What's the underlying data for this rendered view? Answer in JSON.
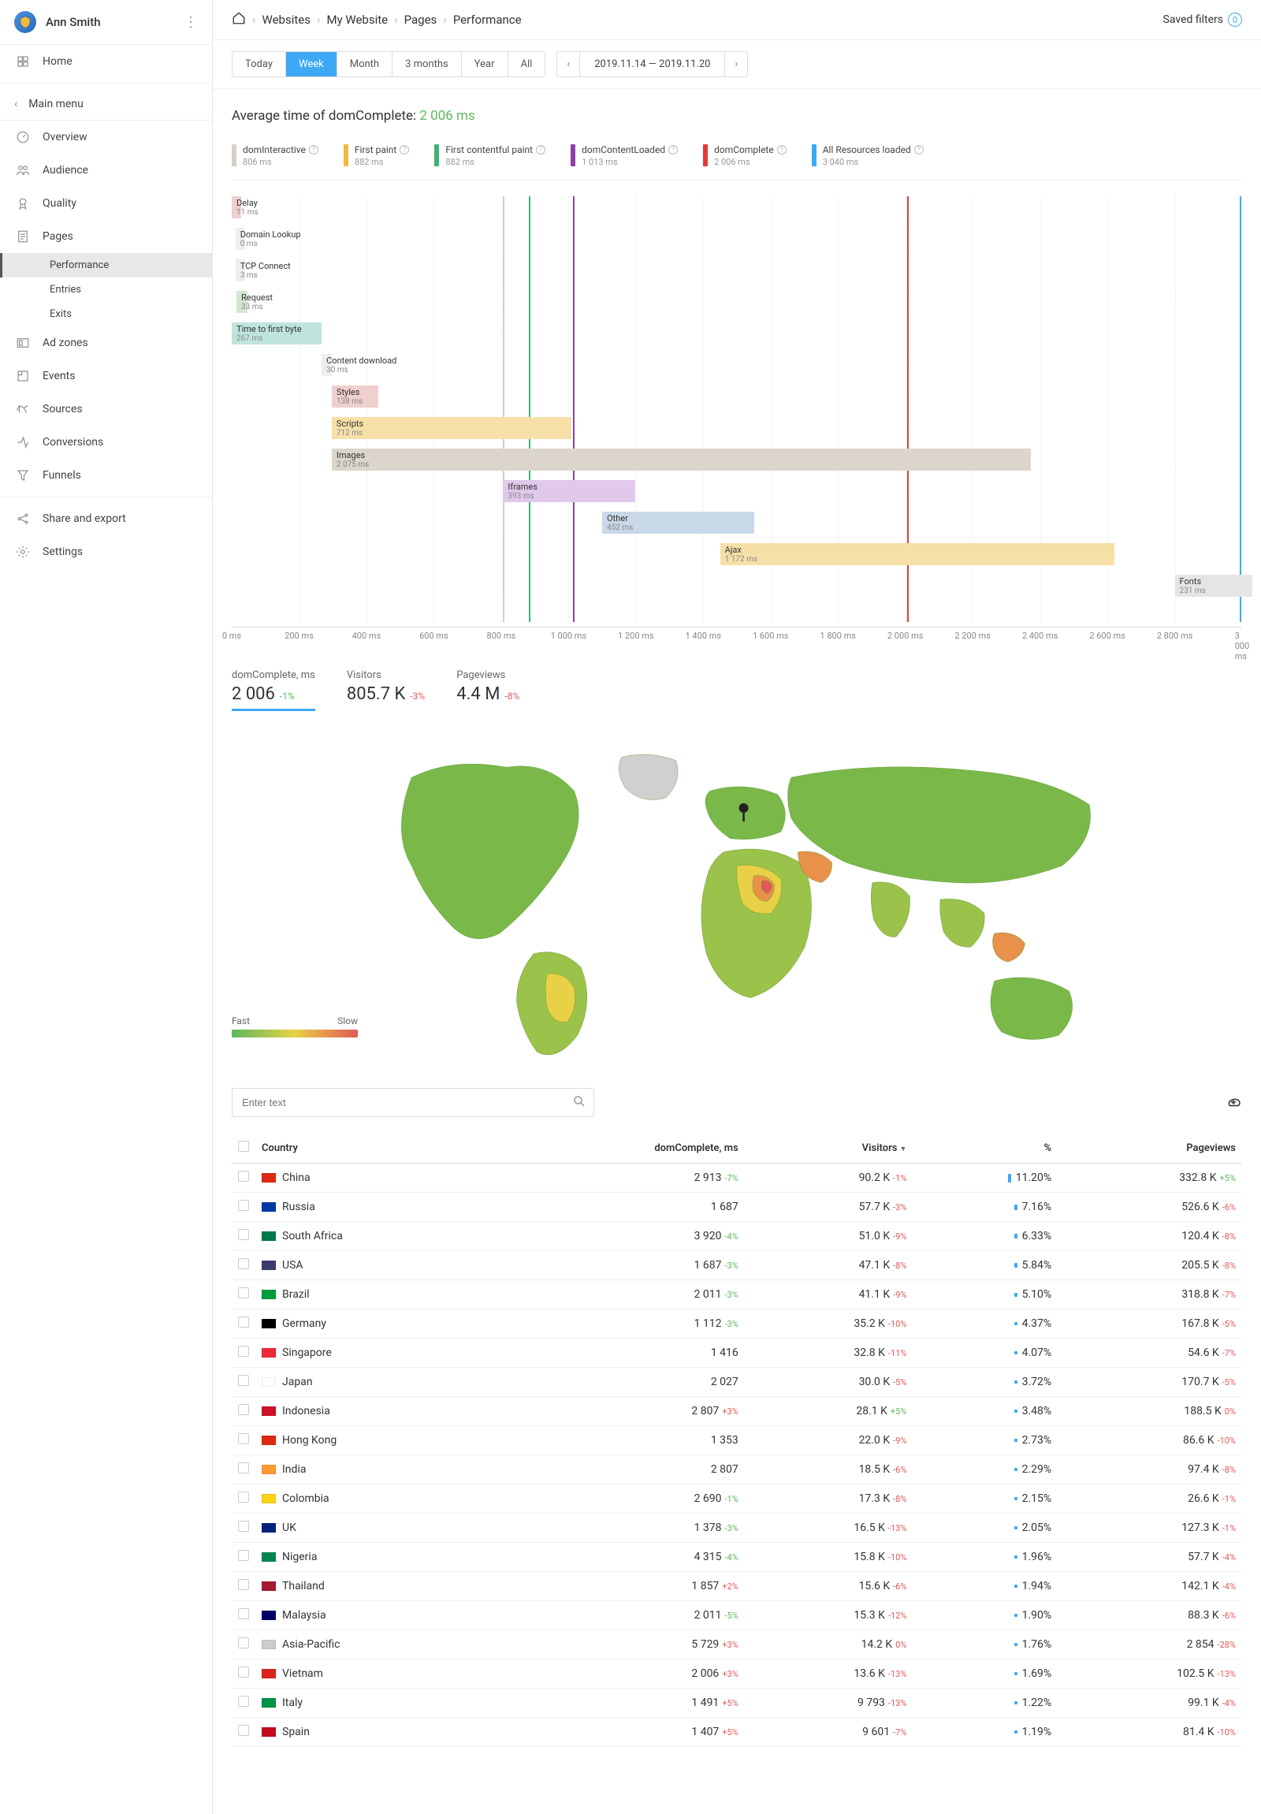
{
  "user": {
    "name": "Ann Smith"
  },
  "sidebar": {
    "home": "Home",
    "main_menu": "Main menu",
    "items": [
      {
        "label": "Overview",
        "icon": "gauge-icon"
      },
      {
        "label": "Audience",
        "icon": "users-icon"
      },
      {
        "label": "Quality",
        "icon": "ribbon-icon"
      },
      {
        "label": "Pages",
        "icon": "pages-icon",
        "expanded": true,
        "children": [
          {
            "label": "Performance",
            "active": true
          },
          {
            "label": "Entries"
          },
          {
            "label": "Exits"
          }
        ]
      },
      {
        "label": "Ad zones",
        "icon": "adzone-icon"
      },
      {
        "label": "Events",
        "icon": "events-icon"
      },
      {
        "label": "Sources",
        "icon": "sources-icon"
      },
      {
        "label": "Conversions",
        "icon": "conversions-icon"
      },
      {
        "label": "Funnels",
        "icon": "funnel-icon"
      }
    ],
    "footer": [
      {
        "label": "Share and export",
        "icon": "share-icon"
      },
      {
        "label": "Settings",
        "icon": "settings-icon"
      }
    ]
  },
  "breadcrumb": [
    "Websites",
    "My Website",
    "Pages",
    "Performance"
  ],
  "saved_filters": "Saved filters",
  "ranges": [
    "Today",
    "Week",
    "Month",
    "3 months",
    "Year",
    "All"
  ],
  "range_active": "Week",
  "date_range": "2019.11.14 — 2019.11.20",
  "chart_title_prefix": "Average time of domComplete: ",
  "chart_title_value": "2 006 ms",
  "legend": [
    {
      "name": "domInteractive",
      "value": "806 ms",
      "color": "#d6cfc5"
    },
    {
      "name": "First paint",
      "value": "882 ms",
      "color": "#f3b93e"
    },
    {
      "name": "First contentful paint",
      "value": "882 ms",
      "color": "#3cb371"
    },
    {
      "name": "domContentLoaded",
      "value": "1 013 ms",
      "color": "#8e3fa8"
    },
    {
      "name": "domComplete",
      "value": "2 006 ms",
      "color": "#e53935"
    },
    {
      "name": "All Resources loaded",
      "value": "3 040 ms",
      "color": "#3da9f5"
    }
  ],
  "chart_data": {
    "type": "bar",
    "xlim": [
      0,
      3000
    ],
    "xlabel_ticks": [
      "0 ms",
      "200 ms",
      "400 ms",
      "600 ms",
      "800 ms",
      "1 000 ms",
      "1 200 ms",
      "1 400 ms",
      "1 600 ms",
      "1 800 ms",
      "2 000 ms",
      "2 200 ms",
      "2 400 ms",
      "2 600 ms",
      "2 800 ms",
      "3 000 ms"
    ],
    "vlines": [
      {
        "x": 806,
        "color": "#d6cfc5"
      },
      {
        "x": 882,
        "color": "#f3b93e"
      },
      {
        "x": 882,
        "color": "#3cb371"
      },
      {
        "x": 1013,
        "color": "#8e3fa8"
      },
      {
        "x": 2006,
        "color": "#e53935"
      },
      {
        "x": 3040,
        "color": "#3da9f5"
      }
    ],
    "bars": [
      {
        "label": "Delay",
        "value": "11 ms",
        "start": 0,
        "dur": 11,
        "color": "#f0cfcf"
      },
      {
        "label": "Domain Lookup",
        "value": "0 ms",
        "start": 11,
        "dur": 0,
        "color": "#eee"
      },
      {
        "label": "TCP Connect",
        "value": "3 ms",
        "start": 11,
        "dur": 3,
        "color": "#eee"
      },
      {
        "label": "Request",
        "value": "33 ms",
        "start": 14,
        "dur": 33,
        "color": "#d3e8d3"
      },
      {
        "label": "Time to first byte",
        "value": "267 ms",
        "start": 0,
        "dur": 267,
        "color": "#bfe4dd"
      },
      {
        "label": "Content download",
        "value": "30 ms",
        "start": 267,
        "dur": 30,
        "color": "#eee"
      },
      {
        "label": "Styles",
        "value": "138 ms",
        "start": 297,
        "dur": 138,
        "color": "#f0cfcf"
      },
      {
        "label": "Scripts",
        "value": "712 ms",
        "start": 297,
        "dur": 712,
        "color": "#f6e0a8"
      },
      {
        "label": "Images",
        "value": "2 075 ms",
        "start": 297,
        "dur": 2075,
        "color": "#dcd5cb"
      },
      {
        "label": "Iframes",
        "value": "393 ms",
        "start": 806,
        "dur": 393,
        "color": "#e0c9ea"
      },
      {
        "label": "Other",
        "value": "452 ms",
        "start": 1100,
        "dur": 452,
        "color": "#c9d8e8"
      },
      {
        "label": "Ajax",
        "value": "1 172 ms",
        "start": 1450,
        "dur": 1172,
        "color": "#f6e0a8"
      },
      {
        "label": "Fonts",
        "value": "231 ms",
        "start": 2800,
        "dur": 231,
        "color": "#e5e5e5"
      }
    ]
  },
  "stats": [
    {
      "label": "domComplete, ms",
      "value": "2 006",
      "delta": "-1%",
      "delta_class": "green-t",
      "active": true
    },
    {
      "label": "Visitors",
      "value": "805.7 K",
      "delta": "-3%",
      "delta_class": "red-t"
    },
    {
      "label": "Pageviews",
      "value": "4.4 M",
      "delta": "-8%",
      "delta_class": "red-t"
    }
  ],
  "map_legend": {
    "fast": "Fast",
    "slow": "Slow"
  },
  "search_placeholder": "Enter text",
  "table": {
    "headers": [
      "Country",
      "domComplete, ms",
      "Visitors",
      "%",
      "Pageviews"
    ],
    "sort_col": "Visitors",
    "rows": [
      {
        "flag": "#de2910",
        "country": "China",
        "dom": "2 913",
        "dom_d": "-7%",
        "dom_c": "green-t",
        "vis": "90.2 K",
        "vis_d": "-1%",
        "vis_c": "red-t",
        "pct": "11.20%",
        "pv": "332.8 K",
        "pv_d": "+5%",
        "pv_c": "green-t"
      },
      {
        "flag": "#0039a6",
        "country": "Russia",
        "dom": "1 687",
        "dom_d": "",
        "dom_c": "",
        "vis": "57.7 K",
        "vis_d": "-3%",
        "vis_c": "red-t",
        "pct": "7.16%",
        "pv": "526.6 K",
        "pv_d": "-6%",
        "pv_c": "red-t"
      },
      {
        "flag": "#007a4d",
        "country": "South Africa",
        "dom": "3 920",
        "dom_d": "-4%",
        "dom_c": "green-t",
        "vis": "51.0 K",
        "vis_d": "-9%",
        "vis_c": "red-t",
        "pct": "6.33%",
        "pv": "120.4 K",
        "pv_d": "-8%",
        "pv_c": "red-t"
      },
      {
        "flag": "#3c3b6e",
        "country": "USA",
        "dom": "1 687",
        "dom_d": "-3%",
        "dom_c": "green-t",
        "vis": "47.1 K",
        "vis_d": "-8%",
        "vis_c": "red-t",
        "pct": "5.84%",
        "pv": "205.5 K",
        "pv_d": "-8%",
        "pv_c": "red-t"
      },
      {
        "flag": "#009c3b",
        "country": "Brazil",
        "dom": "2 011",
        "dom_d": "-3%",
        "dom_c": "green-t",
        "vis": "41.1 K",
        "vis_d": "-9%",
        "vis_c": "red-t",
        "pct": "5.10%",
        "pv": "318.8 K",
        "pv_d": "-7%",
        "pv_c": "red-t"
      },
      {
        "flag": "#000000",
        "country": "Germany",
        "dom": "1 112",
        "dom_d": "-3%",
        "dom_c": "green-t",
        "vis": "35.2 K",
        "vis_d": "-10%",
        "vis_c": "red-t",
        "pct": "4.37%",
        "pv": "167.8 K",
        "pv_d": "-5%",
        "pv_c": "red-t"
      },
      {
        "flag": "#ed2939",
        "country": "Singapore",
        "dom": "1 416",
        "dom_d": "",
        "dom_c": "",
        "vis": "32.8 K",
        "vis_d": "-11%",
        "vis_c": "red-t",
        "pct": "4.07%",
        "pv": "54.6 K",
        "pv_d": "-7%",
        "pv_c": "red-t"
      },
      {
        "flag": "#ffffff",
        "country": "Japan",
        "dom": "2 027",
        "dom_d": "",
        "dom_c": "",
        "vis": "30.0 K",
        "vis_d": "-5%",
        "vis_c": "red-t",
        "pct": "3.72%",
        "pv": "170.7 K",
        "pv_d": "-5%",
        "pv_c": "red-t"
      },
      {
        "flag": "#ce1126",
        "country": "Indonesia",
        "dom": "2 807",
        "dom_d": "+3%",
        "dom_c": "red-t",
        "vis": "28.1 K",
        "vis_d": "+5%",
        "vis_c": "green-t",
        "pct": "3.48%",
        "pv": "188.5 K",
        "pv_d": "0%",
        "pv_c": "red-t"
      },
      {
        "flag": "#de2910",
        "country": "Hong Kong",
        "dom": "1 353",
        "dom_d": "",
        "dom_c": "",
        "vis": "22.0 K",
        "vis_d": "-9%",
        "vis_c": "red-t",
        "pct": "2.73%",
        "pv": "86.6 K",
        "pv_d": "-10%",
        "pv_c": "red-t"
      },
      {
        "flag": "#ff9933",
        "country": "India",
        "dom": "2 807",
        "dom_d": "",
        "dom_c": "",
        "vis": "18.5 K",
        "vis_d": "-6%",
        "vis_c": "red-t",
        "pct": "2.29%",
        "pv": "97.4 K",
        "pv_d": "-8%",
        "pv_c": "red-t"
      },
      {
        "flag": "#fcd116",
        "country": "Colombia",
        "dom": "2 690",
        "dom_d": "-1%",
        "dom_c": "green-t",
        "vis": "17.3 K",
        "vis_d": "-8%",
        "vis_c": "red-t",
        "pct": "2.15%",
        "pv": "26.6 K",
        "pv_d": "-1%",
        "pv_c": "red-t"
      },
      {
        "flag": "#00247d",
        "country": "UK",
        "dom": "1 378",
        "dom_d": "-3%",
        "dom_c": "green-t",
        "vis": "16.5 K",
        "vis_d": "-13%",
        "vis_c": "red-t",
        "pct": "2.05%",
        "pv": "127.3 K",
        "pv_d": "-1%",
        "pv_c": "red-t"
      },
      {
        "flag": "#008751",
        "country": "Nigeria",
        "dom": "4 315",
        "dom_d": "-4%",
        "dom_c": "green-t",
        "vis": "15.8 K",
        "vis_d": "-10%",
        "vis_c": "red-t",
        "pct": "1.96%",
        "pv": "57.7 K",
        "pv_d": "-4%",
        "pv_c": "red-t"
      },
      {
        "flag": "#a51931",
        "country": "Thailand",
        "dom": "1 857",
        "dom_d": "+2%",
        "dom_c": "red-t",
        "vis": "15.6 K",
        "vis_d": "-6%",
        "vis_c": "red-t",
        "pct": "1.94%",
        "pv": "142.1 K",
        "pv_d": "-4%",
        "pv_c": "red-t"
      },
      {
        "flag": "#010066",
        "country": "Malaysia",
        "dom": "2 011",
        "dom_d": "-5%",
        "dom_c": "green-t",
        "vis": "15.3 K",
        "vis_d": "-12%",
        "vis_c": "red-t",
        "pct": "1.90%",
        "pv": "88.3 K",
        "pv_d": "-6%",
        "pv_c": "red-t"
      },
      {
        "flag": "#cccccc",
        "country": "Asia-Pacific",
        "dom": "5 729",
        "dom_d": "+3%",
        "dom_c": "red-t",
        "vis": "14.2 K",
        "vis_d": "0%",
        "vis_c": "red-t",
        "pct": "1.76%",
        "pv": "2 854",
        "pv_d": "-28%",
        "pv_c": "red-t"
      },
      {
        "flag": "#da251d",
        "country": "Vietnam",
        "dom": "2 006",
        "dom_d": "+3%",
        "dom_c": "red-t",
        "vis": "13.6 K",
        "vis_d": "-13%",
        "vis_c": "red-t",
        "pct": "1.69%",
        "pv": "102.5 K",
        "pv_d": "-13%",
        "pv_c": "red-t"
      },
      {
        "flag": "#009246",
        "country": "Italy",
        "dom": "1 491",
        "dom_d": "+5%",
        "dom_c": "red-t",
        "vis": "9 793",
        "vis_d": "-13%",
        "vis_c": "red-t",
        "pct": "1.22%",
        "pv": "99.1 K",
        "pv_d": "-4%",
        "pv_c": "red-t"
      },
      {
        "flag": "#c60b1e",
        "country": "Spain",
        "dom": "1 407",
        "dom_d": "+5%",
        "dom_c": "red-t",
        "vis": "9 601",
        "vis_d": "-7%",
        "vis_c": "red-t",
        "pct": "1.19%",
        "pv": "81.4 K",
        "pv_d": "-10%",
        "pv_c": "red-t"
      }
    ]
  }
}
